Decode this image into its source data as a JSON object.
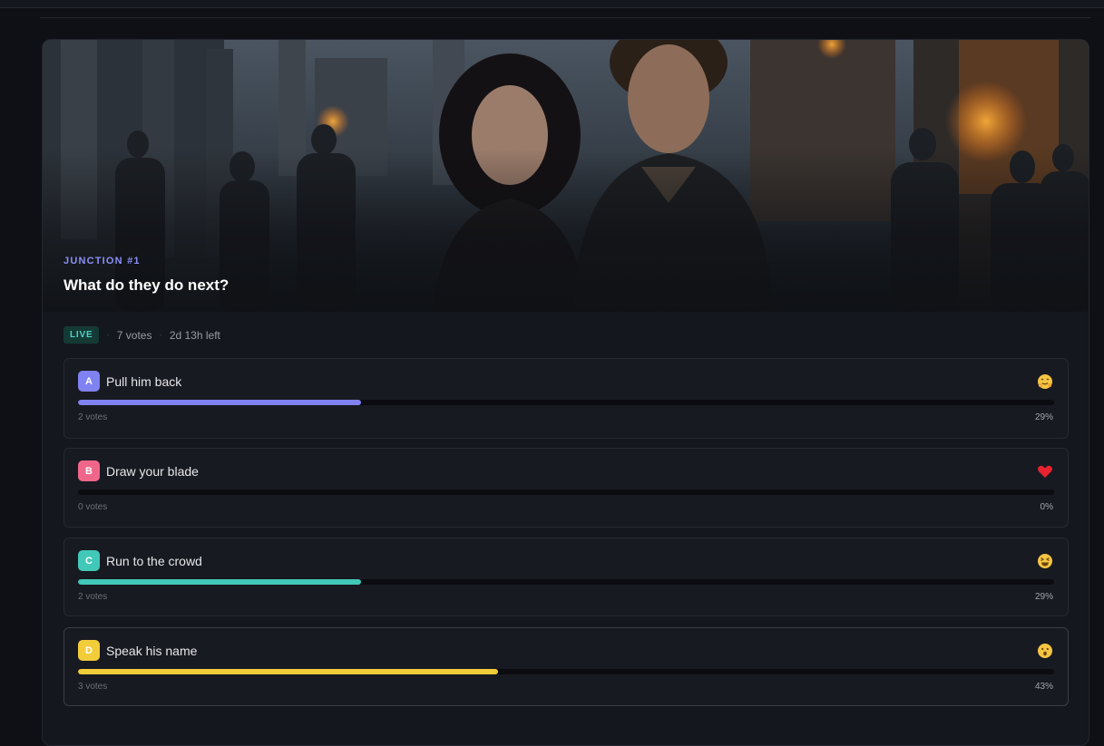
{
  "junction": {
    "label": "JUNCTION #1",
    "question": "What do they do next?"
  },
  "status": {
    "badge": "LIVE",
    "votes": "7 votes",
    "time_left": "2d 13h left"
  },
  "options": [
    {
      "letter": "A",
      "label": "Pull him back",
      "votes_text": "2 votes",
      "percent_text": "29%",
      "fill_percent": 29,
      "color": "#7f82f0",
      "emoji": "hugging-face-icon"
    },
    {
      "letter": "B",
      "label": "Draw your blade",
      "votes_text": "0 votes",
      "percent_text": "0%",
      "fill_percent": 0,
      "color": "#f0668a",
      "emoji": "red-heart-icon"
    },
    {
      "letter": "C",
      "label": "Run to the crowd",
      "votes_text": "2 votes",
      "percent_text": "29%",
      "fill_percent": 29,
      "color": "#42c8b8",
      "emoji": "laughing-face-icon"
    },
    {
      "letter": "D",
      "label": "Speak his name",
      "votes_text": "3 votes",
      "percent_text": "43%",
      "fill_percent": 43,
      "color": "#f3cc3a",
      "emoji": "surprised-face-icon"
    }
  ]
}
